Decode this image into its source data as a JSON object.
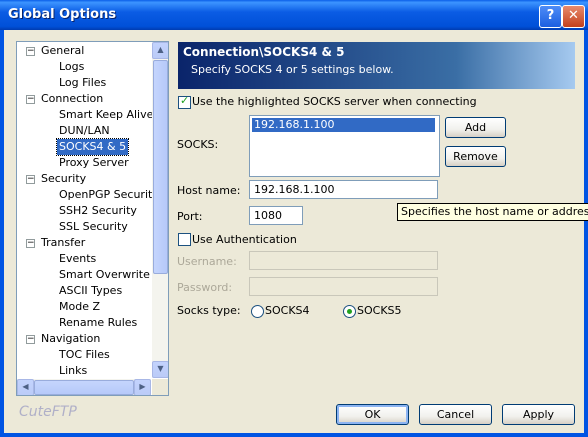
{
  "window": {
    "title": "Global Options",
    "help_label": "?",
    "close_label": "✕"
  },
  "tree": {
    "items": [
      {
        "label": "General",
        "level": 0,
        "expander": "−"
      },
      {
        "label": "Logs",
        "level": 1
      },
      {
        "label": "Log Files",
        "level": 1
      },
      {
        "label": "Connection",
        "level": 0,
        "expander": "−"
      },
      {
        "label": "Smart Keep Alive",
        "level": 1
      },
      {
        "label": "DUN/LAN",
        "level": 1
      },
      {
        "label": "SOCKS4 & 5",
        "level": 1,
        "selected": true
      },
      {
        "label": "Proxy Server",
        "level": 1
      },
      {
        "label": "Security",
        "level": 0,
        "expander": "−"
      },
      {
        "label": "OpenPGP Security",
        "level": 1
      },
      {
        "label": "SSH2 Security",
        "level": 1
      },
      {
        "label": "SSL Security",
        "level": 1
      },
      {
        "label": "Transfer",
        "level": 0,
        "expander": "−"
      },
      {
        "label": "Events",
        "level": 1
      },
      {
        "label": "Smart Overwrite",
        "level": 1
      },
      {
        "label": "ASCII Types",
        "level": 1
      },
      {
        "label": "Mode Z",
        "level": 1
      },
      {
        "label": "Rename Rules",
        "level": 1
      },
      {
        "label": "Navigation",
        "level": 0,
        "expander": "−"
      },
      {
        "label": "TOC Files",
        "level": 1
      },
      {
        "label": "Links",
        "level": 1
      }
    ]
  },
  "header": {
    "title": "Connection\\SOCKS4 & 5",
    "subtitle": "Specify SOCKS 4 or 5 settings below."
  },
  "use_socks": {
    "label": "Use the highlighted SOCKS server when connecting",
    "checked": true
  },
  "socks": {
    "label": "SOCKS:",
    "servers": [
      "192.168.1.100"
    ],
    "add_label": "Add",
    "remove_label": "Remove"
  },
  "host": {
    "label": "Host name:",
    "value": "192.168.1.100"
  },
  "port": {
    "label": "Port:",
    "value": "1080"
  },
  "auth": {
    "label": "Use Authentication",
    "checked": false
  },
  "username": {
    "label": "Username:",
    "value": ""
  },
  "password": {
    "label": "Password:",
    "value": ""
  },
  "socks_type": {
    "label": "Socks type:",
    "options": [
      "SOCKS4",
      "SOCKS5"
    ],
    "selected": "SOCKS5"
  },
  "tooltip": "Specifies the host name or address for the",
  "logo": "CuteFTP",
  "buttons": {
    "ok": "OK",
    "cancel": "Cancel",
    "apply": "Apply"
  }
}
